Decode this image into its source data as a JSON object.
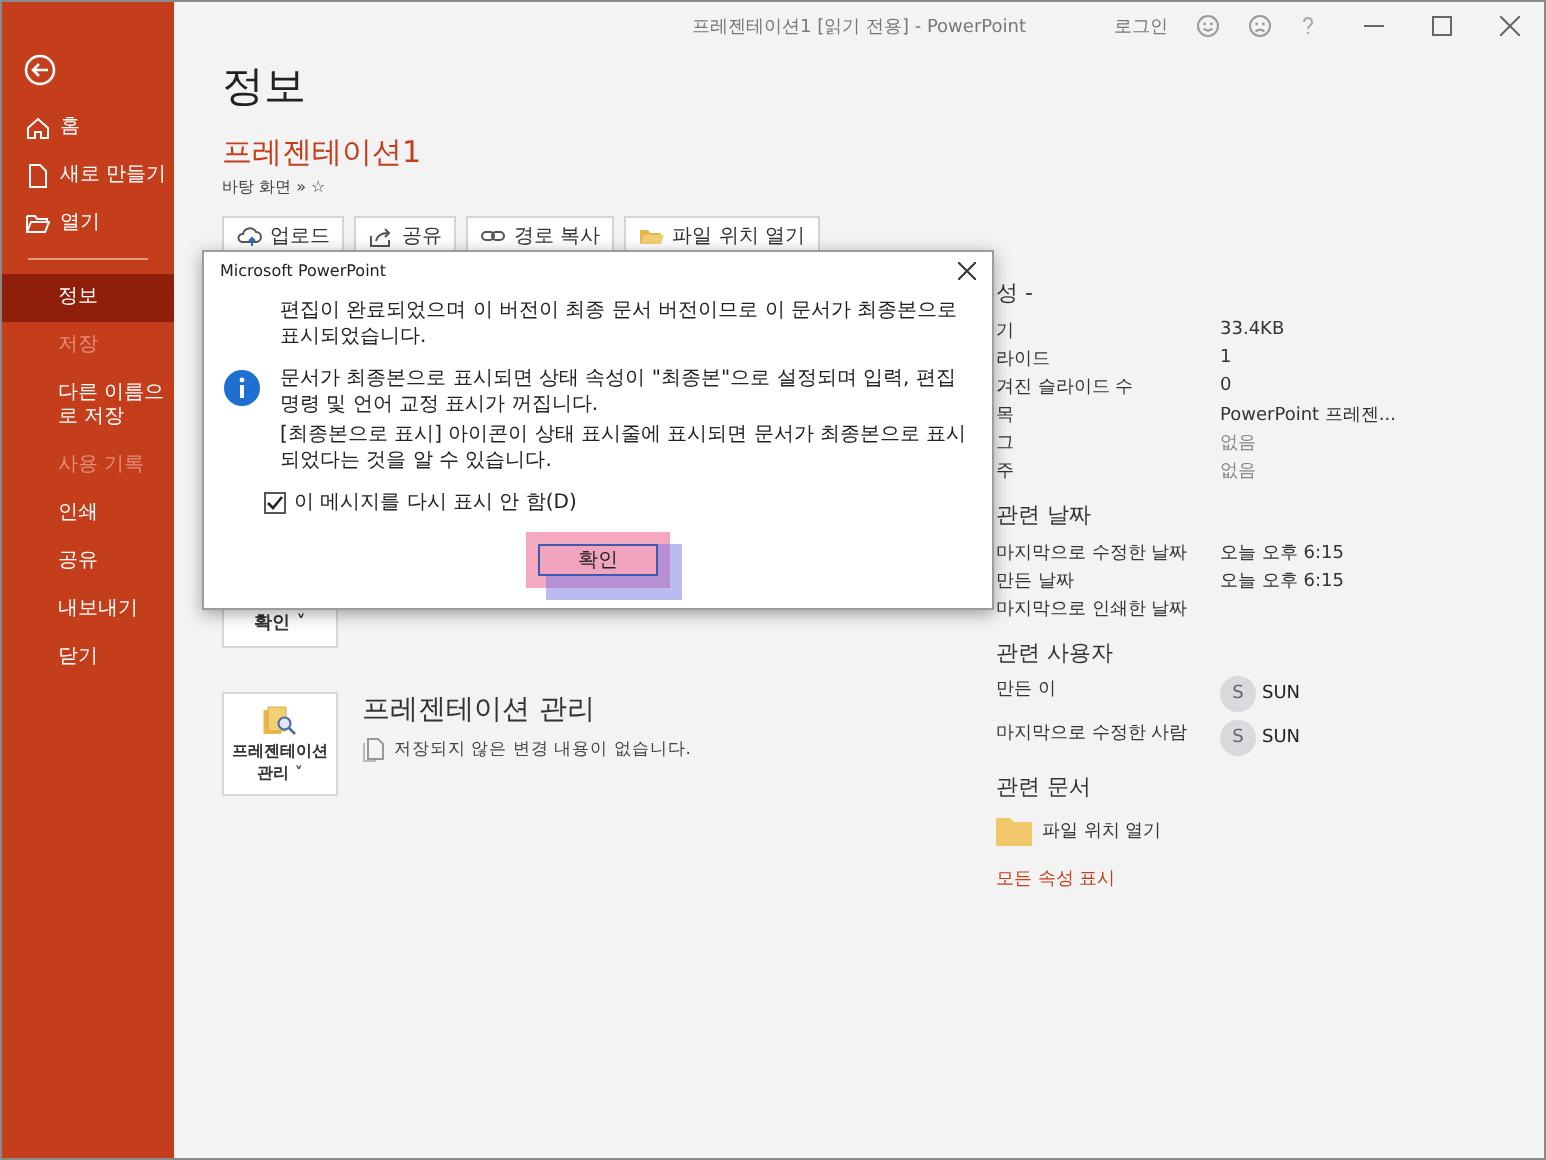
{
  "window": {
    "title": "프레젠테이션1 [읽기 전용] - PowerPoint",
    "sign_in": "로그인"
  },
  "sidebar": {
    "items": [
      {
        "label": "홈",
        "kind": "home",
        "selected": false,
        "disabled": false
      },
      {
        "label": "새로 만들기",
        "kind": "new",
        "selected": false,
        "disabled": false
      },
      {
        "label": "열기",
        "kind": "open",
        "selected": false,
        "disabled": false
      },
      {
        "kind": "divider"
      },
      {
        "label": "정보",
        "kind": "plain",
        "selected": true,
        "disabled": false
      },
      {
        "label": "저장",
        "kind": "plain",
        "selected": false,
        "disabled": true
      },
      {
        "label": "다른 이름으로 저장",
        "kind": "plain",
        "selected": false,
        "disabled": false
      },
      {
        "label": "사용 기록",
        "kind": "plain",
        "selected": false,
        "disabled": true
      },
      {
        "label": "인쇄",
        "kind": "plain",
        "selected": false,
        "disabled": false
      },
      {
        "label": "공유",
        "kind": "plain",
        "selected": false,
        "disabled": false
      },
      {
        "label": "내보내기",
        "kind": "plain",
        "selected": false,
        "disabled": false
      },
      {
        "label": "닫기",
        "kind": "plain",
        "selected": false,
        "disabled": false
      }
    ]
  },
  "page": {
    "heading": "정보",
    "document_name": "프레젠테이션1",
    "location": "바탕 화면 » ☆",
    "actions": [
      {
        "label": "업로드",
        "kind": "upload"
      },
      {
        "label": "공유",
        "kind": "share"
      },
      {
        "label": "경로 복사",
        "kind": "link"
      },
      {
        "label": "파일 위치 열기",
        "kind": "folder"
      }
    ],
    "sections": [
      {
        "button": "확인 ˅",
        "kind": "partial"
      },
      {
        "button": "프레젠테이션 관리 ˅",
        "kind": "manage",
        "title": "프레젠테이션 관리",
        "note": "저장되지 않은 변경 내용이 없습니다."
      }
    ]
  },
  "properties": {
    "heading": "성 -",
    "rows": [
      {
        "label": "기",
        "value": "33.4KB",
        "muted": false
      },
      {
        "label": "라이드",
        "value": "1",
        "muted": false
      },
      {
        "label": "겨진 슬라이드 수",
        "value": "0",
        "muted": false
      },
      {
        "label": "목",
        "value": "PowerPoint 프레젠...",
        "muted": false
      },
      {
        "label": "그",
        "value": "없음",
        "muted": true
      },
      {
        "label": "주",
        "value": "없음",
        "muted": true
      }
    ],
    "dates_heading": "관련 날짜",
    "dates": [
      {
        "label": "마지막으로 수정한 날짜",
        "value": "오늘 오후 6:15"
      },
      {
        "label": "만든 날짜",
        "value": "오늘 오후 6:15"
      },
      {
        "label": "마지막으로 인쇄한 날짜"
      }
    ],
    "people_heading": "관련 사용자",
    "people": [
      {
        "label": "만든 이",
        "initial": "S",
        "name": "SUN"
      },
      {
        "label": "마지막으로 수정한 사람",
        "initial": "S",
        "name": "SUN"
      }
    ],
    "docs_heading": "관련 문서",
    "open_location": "파일 위치 열기",
    "show_all": "모든 속성 표시"
  },
  "dialog": {
    "title": "Microsoft PowerPoint",
    "message": "편집이 완료되었으며 이 버전이 최종 문서 버전이므로 이 문서가 최종본으로 표시되었습니다.",
    "details": [
      "문서가 최종본으로 표시되면 상태 속성이 \"최종본\"으로 설정되며 입력, 편집 명령 및 언어 교정 표시가 꺼집니다.",
      "[최종본으로 표시] 아이콘이 상태 표시줄에 표시되면 문서가 최종본으로 표시되었다는 것을 알 수 있습니다."
    ],
    "checkbox": {
      "label": "이 메시지를 다시 표시 안 함(D)",
      "checked": true
    },
    "ok": "확인",
    "highlighted": true
  }
}
